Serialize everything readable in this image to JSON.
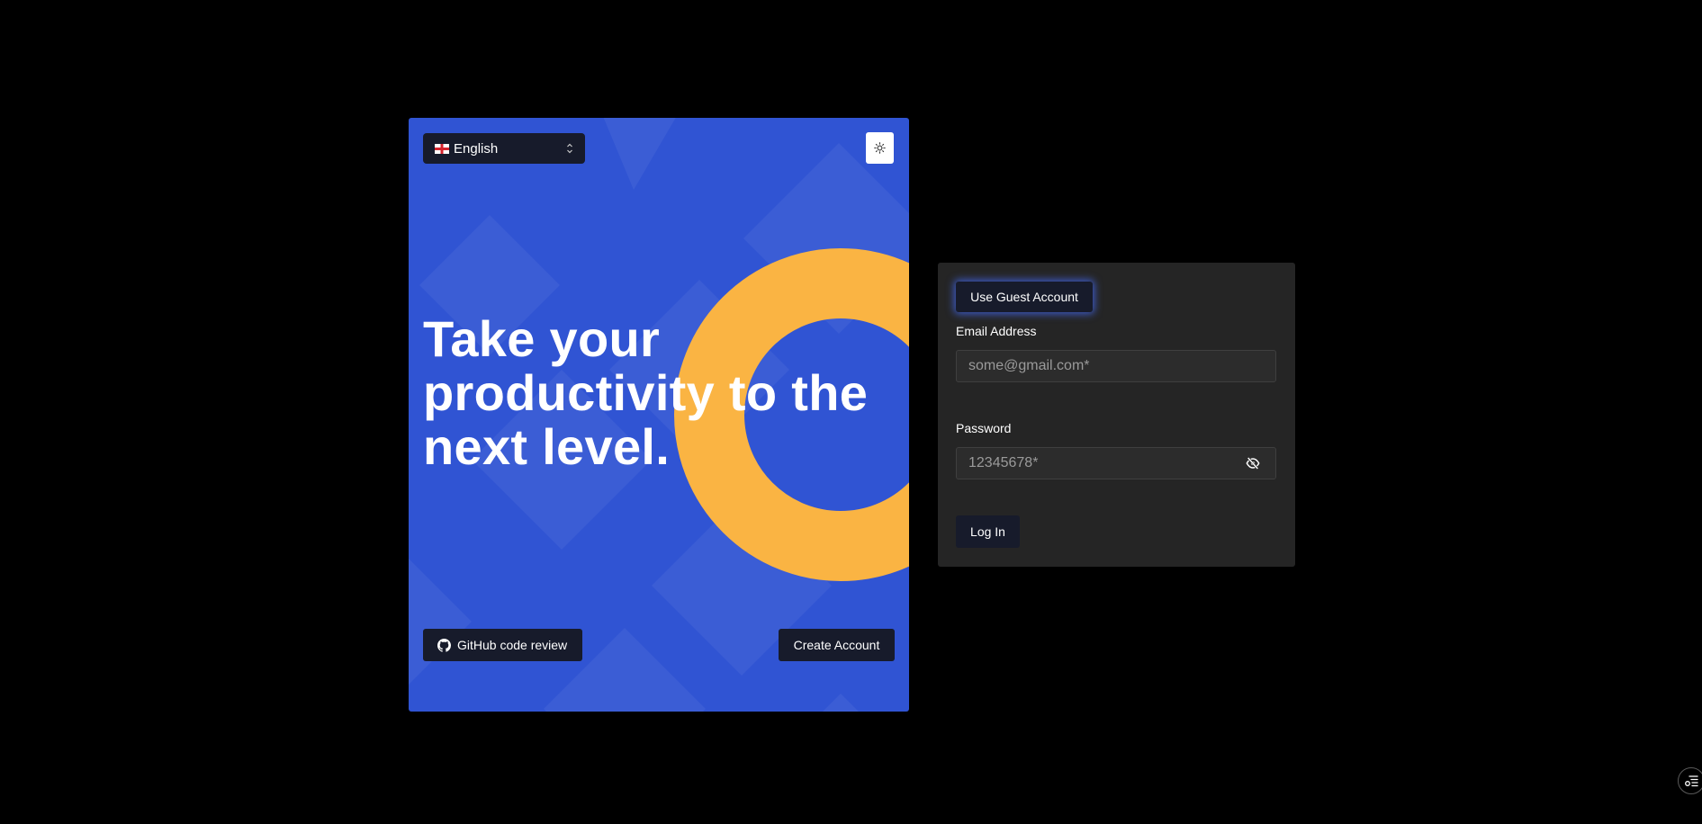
{
  "colors": {
    "page_background": "#000000",
    "hero_blue": "#3054d3",
    "ring_yellow": "#fab443",
    "dark_button": "#171b2b",
    "card_background": "#252525",
    "guest_glow": "#466eff"
  },
  "hero": {
    "language": {
      "flag_icon": "england-flag-icon",
      "selected": "English"
    },
    "theme_toggle_icon": "sun-icon",
    "headline": "Take your productivity to the next level.",
    "github_button": {
      "icon": "github-icon",
      "label": "GitHub code review"
    },
    "create_account_label": "Create Account"
  },
  "login": {
    "guest_button_label": "Use Guest Account",
    "email": {
      "label": "Email Address",
      "placeholder": "some@gmail.com*",
      "value": ""
    },
    "password": {
      "label": "Password",
      "placeholder": "12345678*",
      "value": "",
      "toggle_icon": "eye-off-icon"
    },
    "login_button_label": "Log In"
  },
  "corner_button_icon": "tools-menu-icon"
}
